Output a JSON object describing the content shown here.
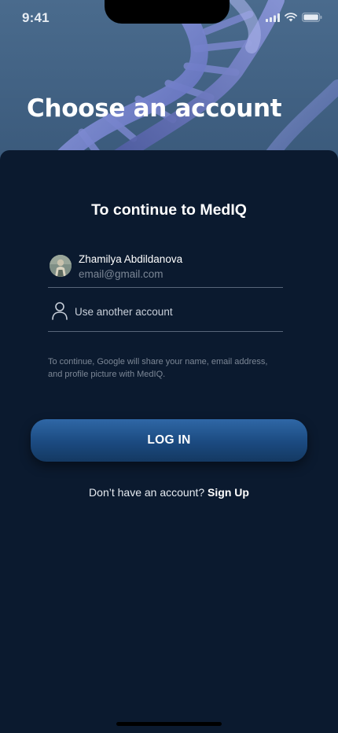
{
  "status_bar": {
    "time": "9:41",
    "icons": [
      "signal-icon",
      "wifi-icon",
      "battery-icon"
    ]
  },
  "hero": {
    "title": "Choose an account",
    "background": "dna-helix-illustration"
  },
  "chooser": {
    "heading": "To continue to MedIQ",
    "account": {
      "name": "Zhamilya Abdildanova",
      "email": "email@gmail.com"
    },
    "another_account_label": "Use another account",
    "consent_text": "To continue, Google will share your name, email address, and profile picture with MedIQ."
  },
  "actions": {
    "login_label": "LOG IN",
    "signup_prompt": "Don’t have an account?",
    "signup_link": "Sign Up"
  },
  "colors": {
    "sheet_background": "#0b1a2f",
    "button_gradient_top": "#2f67a6",
    "button_gradient_bottom": "#143962",
    "divider": "#58667a",
    "muted_text": "#7c8796"
  }
}
